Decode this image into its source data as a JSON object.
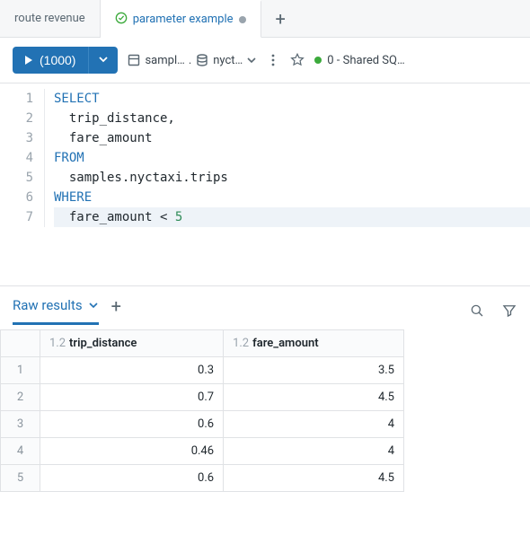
{
  "tabs": {
    "inactive": "route revenue",
    "active": "parameter example"
  },
  "toolbar": {
    "run_label": "(1000)",
    "catalog_left": "sampl…",
    "catalog_right": "nyct…",
    "cluster": "0 - Shared SQ…"
  },
  "code": {
    "lines": [
      {
        "n": "1",
        "pre": "",
        "kw": "SELECT",
        "rest": ""
      },
      {
        "n": "2",
        "pre": "  ",
        "kw": "",
        "rest": "trip_distance,"
      },
      {
        "n": "3",
        "pre": "  ",
        "kw": "",
        "rest": "fare_amount"
      },
      {
        "n": "4",
        "pre": "",
        "kw": "FROM",
        "rest": ""
      },
      {
        "n": "5",
        "pre": "  ",
        "kw": "",
        "rest": "samples.nyctaxi.trips"
      },
      {
        "n": "6",
        "pre": "",
        "kw": "WHERE",
        "rest": ""
      },
      {
        "n": "7",
        "pre": "  ",
        "kw": "",
        "rest": "fare_amount < ",
        "num": "5"
      }
    ]
  },
  "results": {
    "tab_label": "Raw results",
    "col_type": "1.2",
    "col1": "trip_distance",
    "col2": "fare_amount",
    "rows": [
      {
        "n": "1",
        "a": "0.3",
        "b": "3.5"
      },
      {
        "n": "2",
        "a": "0.7",
        "b": "4.5"
      },
      {
        "n": "3",
        "a": "0.6",
        "b": "4"
      },
      {
        "n": "4",
        "a": "0.46",
        "b": "4"
      },
      {
        "n": "5",
        "a": "0.6",
        "b": "4.5"
      }
    ]
  },
  "chart_data": {
    "type": "table",
    "columns": [
      "trip_distance",
      "fare_amount"
    ],
    "rows": [
      [
        0.3,
        3.5
      ],
      [
        0.7,
        4.5
      ],
      [
        0.6,
        4
      ],
      [
        0.46,
        4
      ],
      [
        0.6,
        4.5
      ]
    ]
  }
}
